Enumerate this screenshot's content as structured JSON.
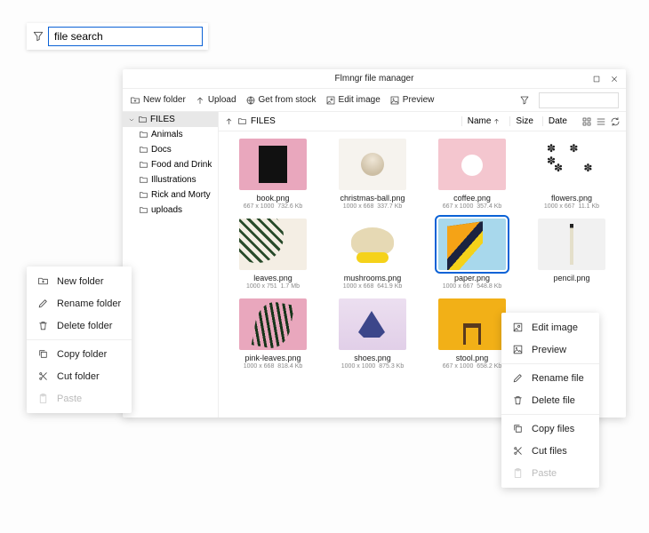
{
  "search": {
    "value": "file search"
  },
  "window": {
    "title": "Flmngr file manager"
  },
  "toolbar": {
    "new_folder": "New folder",
    "upload": "Upload",
    "get_stock": "Get from stock",
    "edit_image": "Edit image",
    "preview": "Preview"
  },
  "sidebar": {
    "root": "FILES",
    "items": [
      "Animals",
      "Docs",
      "Food and Drink",
      "Illustrations",
      "Rick and Morty",
      "uploads"
    ]
  },
  "breadcrumb": {
    "path": "FILES"
  },
  "columns": {
    "name": "Name",
    "size": "Size",
    "date": "Date"
  },
  "files": [
    {
      "name": "book.png",
      "dims": "667 x 1000",
      "size": "732.6 Kb"
    },
    {
      "name": "christmas-ball.png",
      "dims": "1000 x 668",
      "size": "337.7 Kb"
    },
    {
      "name": "coffee.png",
      "dims": "667 x 1000",
      "size": "357.4 Kb"
    },
    {
      "name": "flowers.png",
      "dims": "1000 x 667",
      "size": "11.1 Kb"
    },
    {
      "name": "leaves.png",
      "dims": "1000 x 751",
      "size": "1.7 Mb"
    },
    {
      "name": "mushrooms.png",
      "dims": "1000 x 668",
      "size": "641.9 Kb"
    },
    {
      "name": "paper.png",
      "dims": "1000 x 667",
      "size": "548.8 Kb"
    },
    {
      "name": "pencil.png",
      "dims": "",
      "size": ""
    },
    {
      "name": "pink-leaves.png",
      "dims": "1000 x 668",
      "size": "818.4 Kb"
    },
    {
      "name": "shoes.png",
      "dims": "1000 x 1000",
      "size": "875.3 Kb"
    },
    {
      "name": "stool.png",
      "dims": "667 x 1000",
      "size": "658.2 Kb"
    }
  ],
  "menu_folder": {
    "new": "New folder",
    "rename": "Rename folder",
    "delete": "Delete folder",
    "copy": "Copy folder",
    "cut": "Cut folder",
    "paste": "Paste"
  },
  "menu_file": {
    "edit": "Edit image",
    "preview": "Preview",
    "rename": "Rename file",
    "delete": "Delete file",
    "copy": "Copy files",
    "cut": "Cut files",
    "paste": "Paste"
  }
}
